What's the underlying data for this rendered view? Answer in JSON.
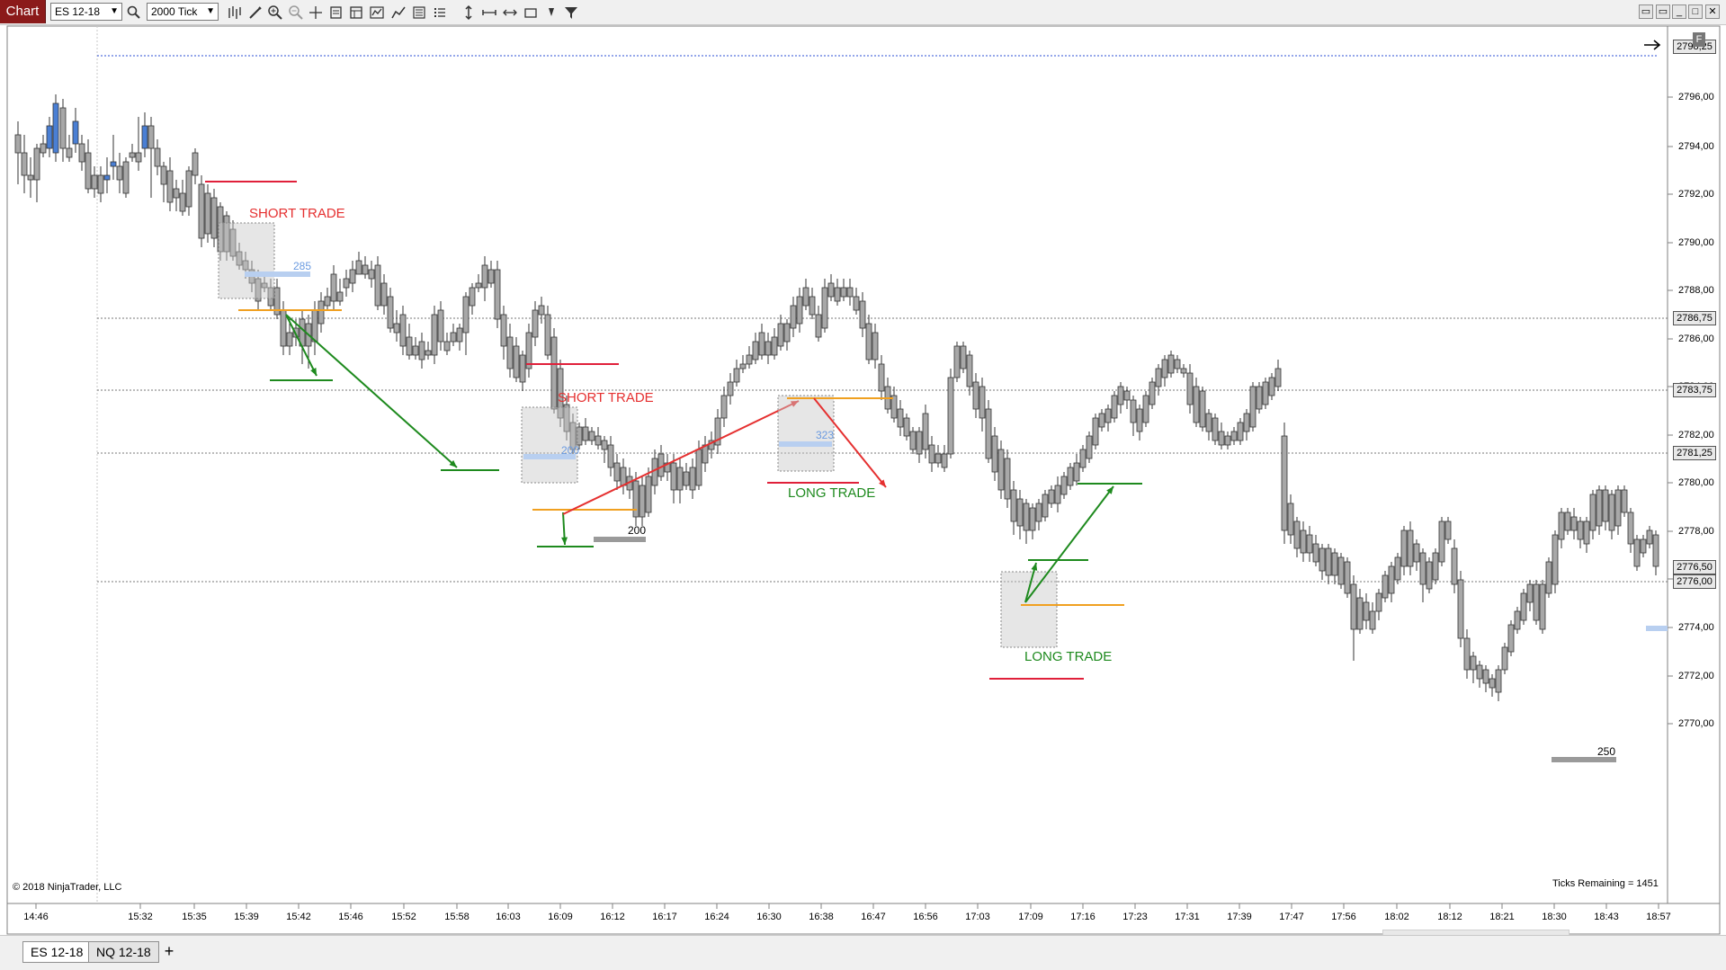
{
  "toolbar": {
    "chart_tab": "Chart",
    "instrument_select": "ES 12-18",
    "interval_select": "2000 Tick"
  },
  "copyright": "© 2018 NinjaTrader, LLC",
  "ticks_remaining": "Ticks Remaining = 1451",
  "f_button": "F",
  "tabs": [
    "ES 12-18",
    "NQ 12-18"
  ],
  "add_tab": "+",
  "price_axis": [
    "2796,00",
    "2794,00",
    "2792,00",
    "2790,00",
    "2788,00",
    "2786,00",
    "2784,00",
    "2782,00",
    "2780,00",
    "2778,00",
    "2776,00",
    "2774,00",
    "2772,00",
    "2770,00"
  ],
  "price_markers": [
    "2798,25",
    "2786,75",
    "2783,75",
    "2781,25",
    "2776,50",
    "2776,00"
  ],
  "time_axis": [
    "14:46",
    "15:32",
    "15:35",
    "15:39",
    "15:42",
    "15:46",
    "15:52",
    "15:58",
    "16:03",
    "16:09",
    "16:12",
    "16:17",
    "16:24",
    "16:30",
    "16:38",
    "16:47",
    "16:56",
    "17:03",
    "17:09",
    "17:16",
    "17:23",
    "17:31",
    "17:39",
    "17:47",
    "17:56",
    "18:02",
    "18:12",
    "18:21",
    "18:30",
    "18:43",
    "18:57"
  ],
  "trades": [
    {
      "label": "SHORT TRADE",
      "color": "#e53030"
    },
    {
      "label": "SHORT TRADE",
      "color": "#e53030"
    },
    {
      "label": "LONG TRADE",
      "color": "#1e8a1e"
    },
    {
      "label": "LONG TRADE",
      "color": "#1e8a1e"
    }
  ],
  "volume_labels": [
    "285",
    "200",
    "323",
    "200",
    "250"
  ],
  "colors": {
    "up_candle": "#4a7fd4",
    "down_candle": "#a8a8a8",
    "stop_line": "#e0203a",
    "entry_line": "#f0a020",
    "profit_line": "#1e8a1e"
  }
}
